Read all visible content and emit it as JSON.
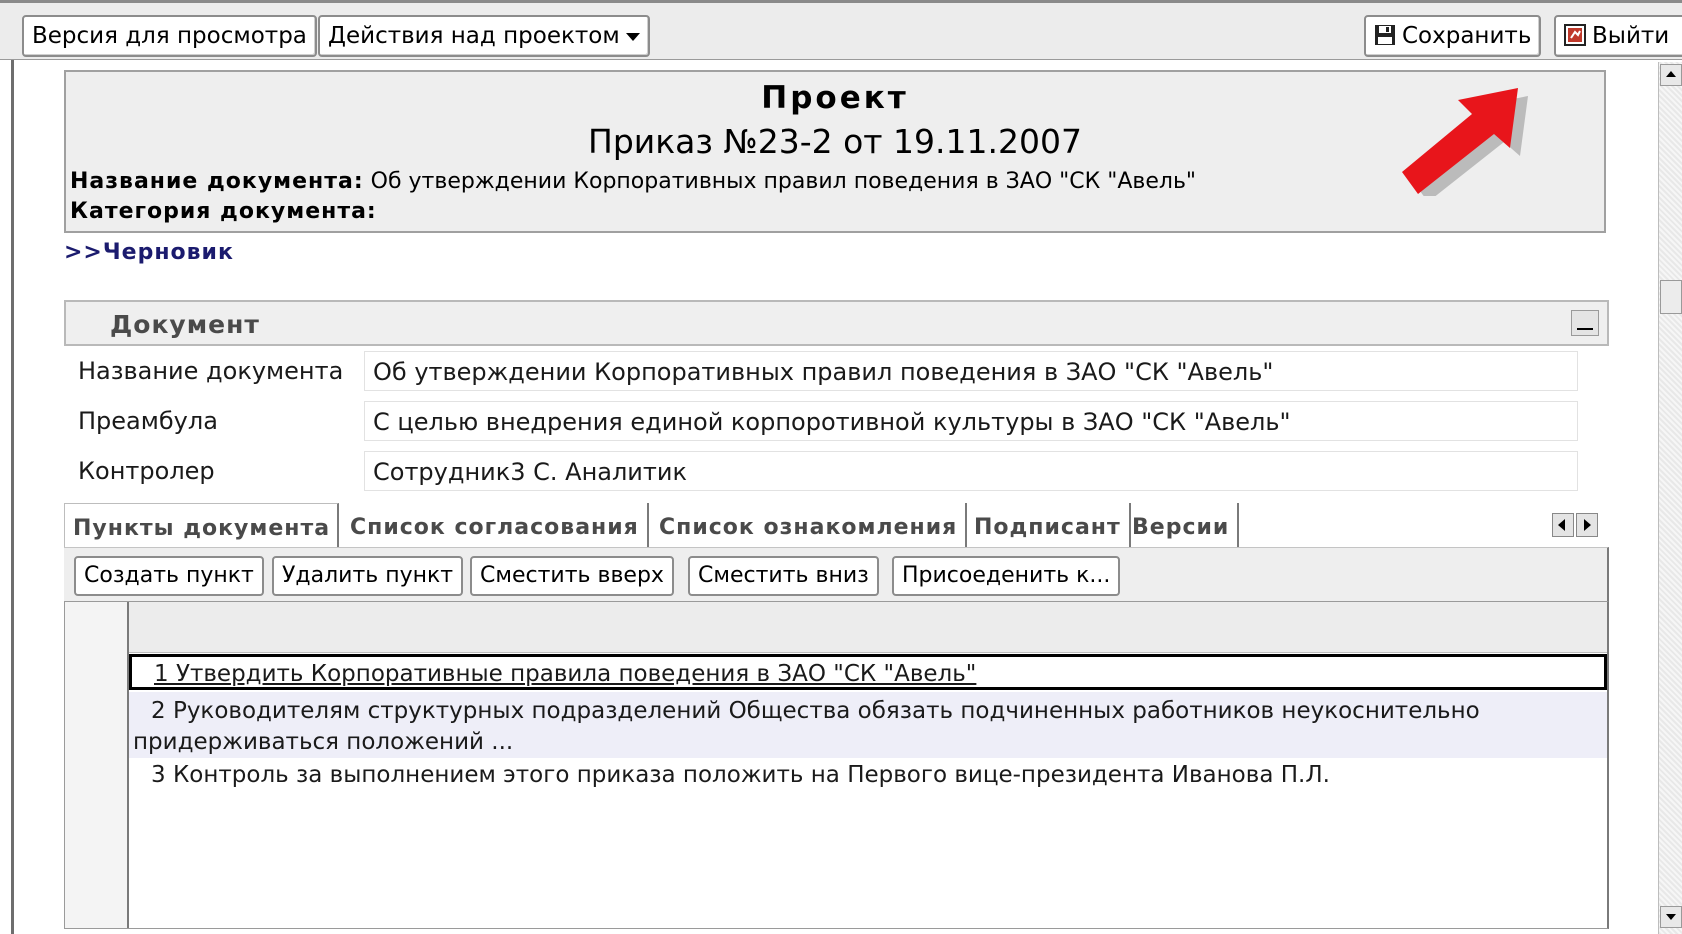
{
  "toolbar": {
    "view_version": "Версия для просмотра",
    "project_actions": "Действия над проектом",
    "save": "Сохранить",
    "exit": "Выйти"
  },
  "header": {
    "title": "Проект",
    "subtitle": "Приказ №23-2 от 19.11.2007",
    "doc_name_label": "Название документа:",
    "doc_name_value": "Об утверждении Корпоративных правил поведения в ЗАО \"СК \"Авель\"",
    "category_label": "Категория документа:"
  },
  "status_link": ">>Черновик",
  "section": {
    "title": "Документ",
    "fields": [
      {
        "label": "Название документа",
        "value": "Об утверждении Корпоративных правил поведения в ЗАО \"СК \"Авель\""
      },
      {
        "label": "Преамбула",
        "value": "С целью внедрения единой корпоротивной культуры в ЗАО \"СК \"Авель\""
      },
      {
        "label": "Контролер",
        "value": "Сотрудник3 С. Аналитик"
      }
    ]
  },
  "tabs": [
    "Пункты документа",
    "Список согласования",
    "Список ознакомления",
    "Подписант",
    "Версии"
  ],
  "actions": [
    "Создать пункт",
    "Удалить пункт",
    "Сместить вверх",
    "Сместить вниз",
    "Присоеденить к..."
  ],
  "items": [
    "1 Утвердить Корпоративные правила поведения в ЗАО \"СК \"Авель\"",
    "2 Руководителям структурных подразделений Общества обязать подчиненных работников неукоснительно придерживаться положений ...",
    "3 Контроль за выполнением этого приказа положить на Первого вице-президента Иванова П.Л."
  ],
  "colors": {
    "arrow": "#e8151b",
    "status_link": "#1b1b6e",
    "alt_row": "#eeeef8"
  }
}
